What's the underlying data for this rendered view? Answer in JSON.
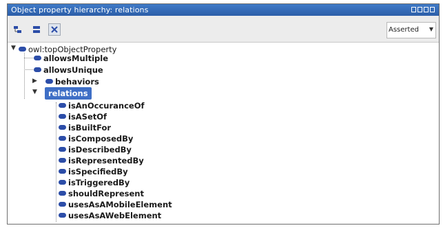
{
  "window": {
    "title": "Object property hierarchy: relations"
  },
  "toolbar": {
    "dropdown_value": "Asserted",
    "buttons": [
      "add-subproperty-icon",
      "add-sibling-icon",
      "delete-icon"
    ]
  },
  "tree": {
    "root": "owl:topObjectProperty",
    "level1": [
      "allowsMultiple",
      "allowsUnique",
      "behaviors",
      "relations"
    ],
    "selected": "relations",
    "children_of_relations": [
      "isAnOccuranceOf",
      "isASetOf",
      "isBuiltFor",
      "isComposedBy",
      "isDescribedBy",
      "isRepresentedBy",
      "isSpecifiedBy",
      "isTriggeredBy",
      "shouldRepresent",
      "usesAsAMobileElement",
      "usesAsAWebElement"
    ]
  },
  "colors": {
    "titlebar": "#2c5ea8",
    "property_dot": "#2c4da8",
    "selection": "#3f6fc6"
  }
}
